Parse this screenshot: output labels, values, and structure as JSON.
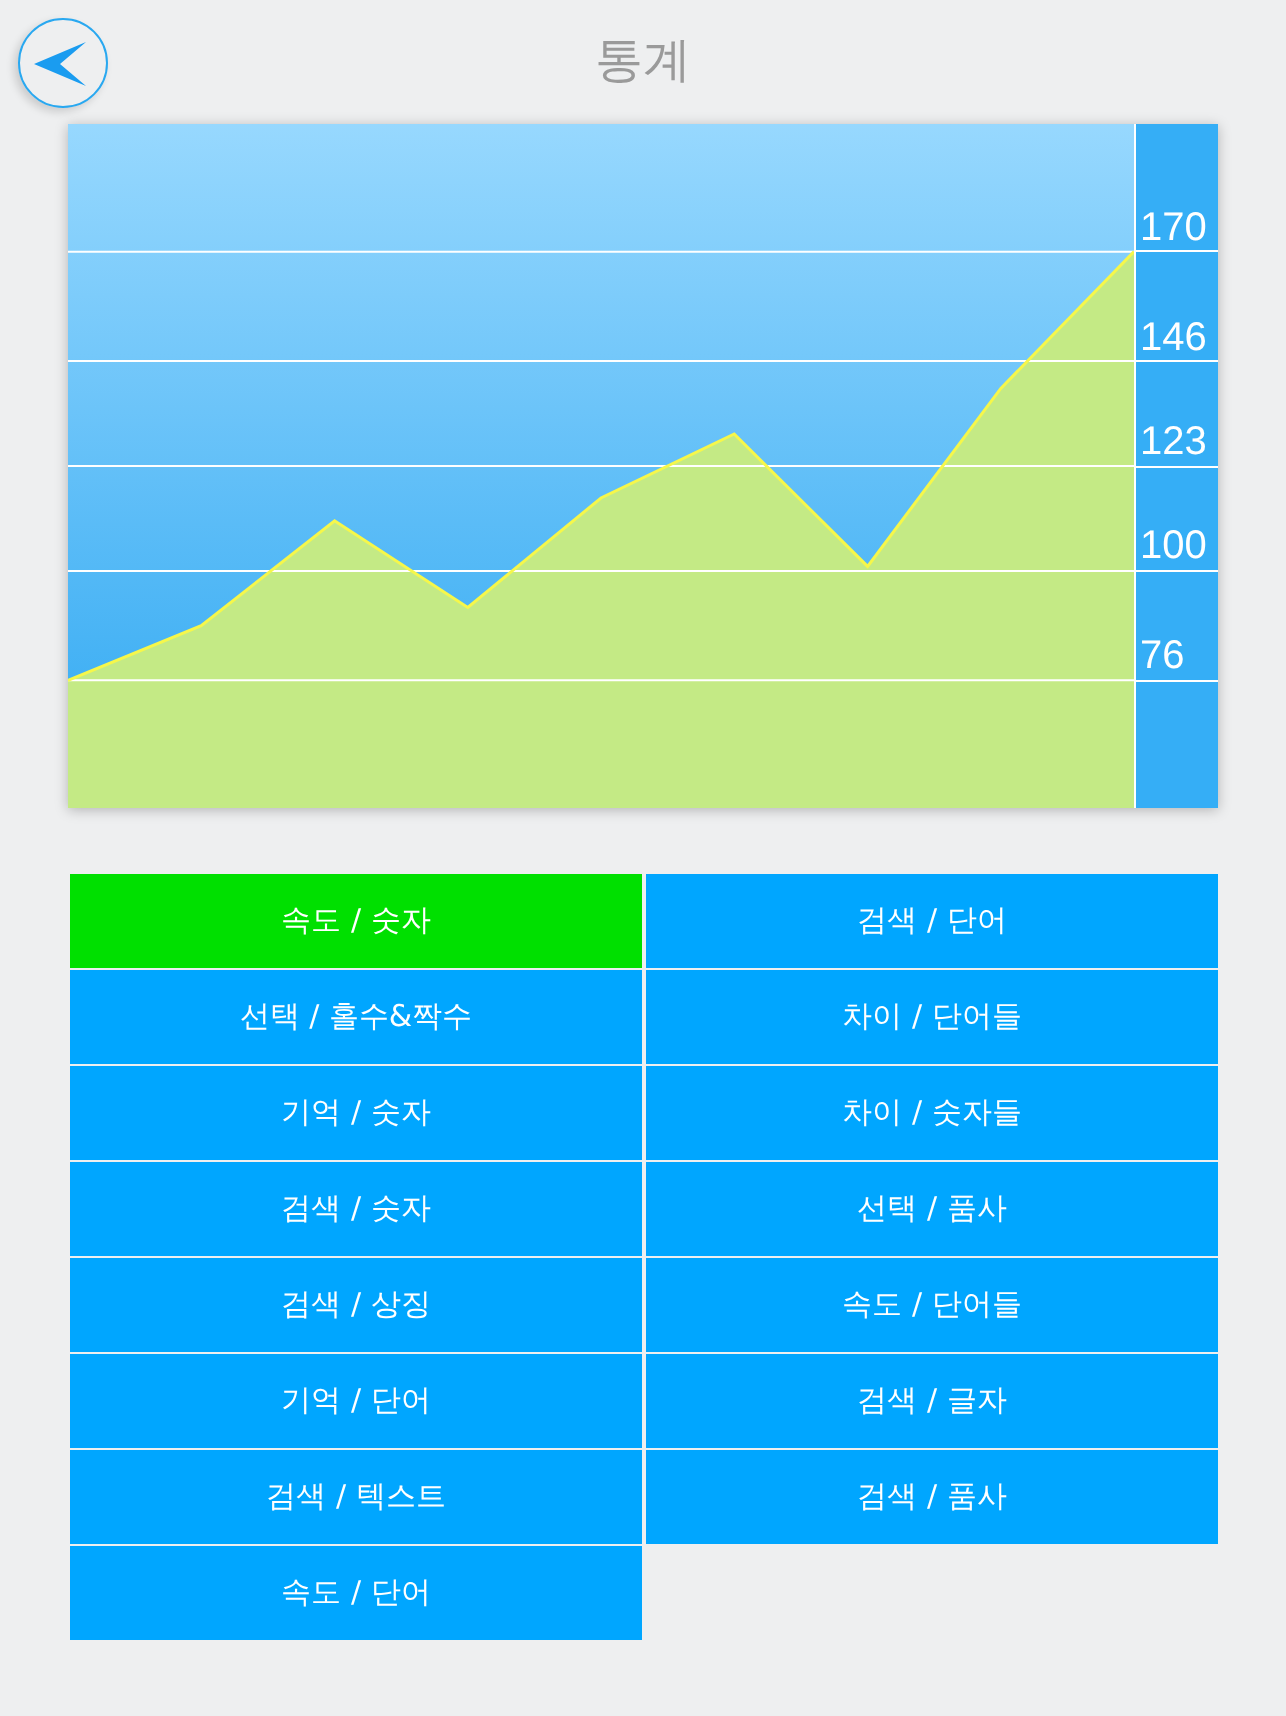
{
  "header": {
    "title": "통계"
  },
  "chart": {
    "chart_data": {
      "type": "area",
      "grid": true,
      "series": [
        {
          "color": "#c4ea85",
          "values": [
            76,
            88,
            111,
            92,
            116,
            130,
            101,
            140,
            170
          ]
        }
      ],
      "ylim": [
        48,
        198
      ],
      "yticks": [
        76,
        100,
        123,
        146,
        170
      ]
    }
  },
  "modes": [
    {
      "label": "속도 / 숫자",
      "selected": true
    },
    {
      "label": "검색 / 단어",
      "selected": false
    },
    {
      "label": "선택 / 홀수&짝수",
      "selected": false
    },
    {
      "label": "차이 / 단어들",
      "selected": false
    },
    {
      "label": "기억 / 숫자",
      "selected": false
    },
    {
      "label": "차이 / 숫자들",
      "selected": false
    },
    {
      "label": "검색 / 숫자",
      "selected": false
    },
    {
      "label": "선택 / 품사",
      "selected": false
    },
    {
      "label": "검색 / 상징",
      "selected": false
    },
    {
      "label": "속도 / 단어들",
      "selected": false
    },
    {
      "label": "기억 / 단어",
      "selected": false
    },
    {
      "label": "검색 / 글자",
      "selected": false
    },
    {
      "label": "검색 / 텍스트",
      "selected": false
    },
    {
      "label": "검색 / 품사",
      "selected": false
    },
    {
      "label": "속도 / 단어",
      "selected": false
    }
  ]
}
